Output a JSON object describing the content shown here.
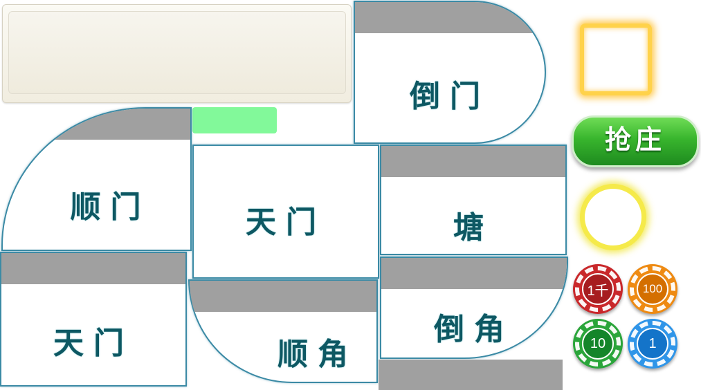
{
  "zones": {
    "daomen_top": "倒门",
    "shunmen": "顺门",
    "tianmen_center": "天门",
    "tang": "塘",
    "tianmen_left": "天门",
    "shunjiao": "顺角",
    "daojiao": "倒角"
  },
  "buttons": {
    "grab_banker": "抢庄"
  },
  "chips": [
    {
      "label": "1千",
      "color": "#c9282b",
      "inner": "#a71d20"
    },
    {
      "label": "100",
      "color": "#ee8a12",
      "inner": "#d46f00"
    },
    {
      "label": "10",
      "color": "#2aa53a",
      "inner": "#14852a"
    },
    {
      "label": "1",
      "color": "#2f95e8",
      "inner": "#1474c9"
    }
  ],
  "colors": {
    "zone_border": "#3b8aa5",
    "zone_text": "#0d5863",
    "bar": "#a0a0a0",
    "slot_green": "#82f99a"
  }
}
